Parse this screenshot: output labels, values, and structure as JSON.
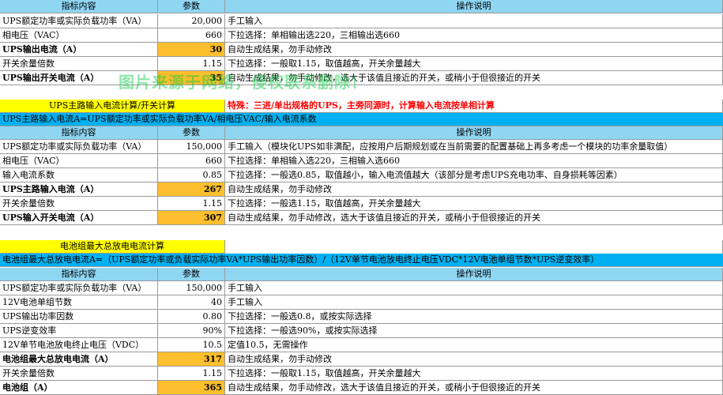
{
  "headers": {
    "col1": "指标内容",
    "col2": "参数",
    "col3": "操作说明"
  },
  "section1": {
    "rows": [
      {
        "label": "UPS额定功率或实际负载功率（VA）",
        "value": "20,000",
        "note": "手工输入",
        "bold": false,
        "highlight": false
      },
      {
        "label": "相电压（VAC）",
        "value": "660",
        "note": "下拉选择：单相输出选220，三相输出选660",
        "bold": false,
        "highlight": false
      },
      {
        "label": "UPS输出电流（A）",
        "value": "30",
        "note": "自动生成结果，勿手动修改",
        "bold": true,
        "highlight": true
      },
      {
        "label": "开关余量倍数",
        "value": "1.15",
        "note": "下拉选择：一般取1.15，取值越高，开关余量越大",
        "bold": false,
        "highlight": false
      },
      {
        "label": "UPS输出开关电流（A）",
        "value": "35",
        "note": "自动生成结果，勿手动修改，选大于该值且接近的开关，或稍小于但很接近的开关",
        "bold": true,
        "highlight": true
      }
    ]
  },
  "watermark": "图片来源于网络，侵权联系删除！",
  "section2": {
    "title": "UPS主路输入电流计算/开关计算",
    "special": "特殊：三进/单出规格的UPS，主旁同源时，计算输入电流按单相计算",
    "formula": "UPS主路输入电流A=UPS额定功率或实际负载功率VA/相电压VAC/输入电流系数",
    "rows": [
      {
        "label": "UPS额定功率或实际负载功率（VA）",
        "value": "150,000",
        "note": "手工输入（模块化UPS如非满配，应按用户后期规划或在当前需要的配置基础上再多考虑一个模块的功率余量取值）",
        "bold": false,
        "highlight": false
      },
      {
        "label": "相电压（VAC）",
        "value": "660",
        "note": "下拉选择：单相输入选220，三相输入选660",
        "bold": false,
        "highlight": false
      },
      {
        "label": "输入电流系数",
        "value": "0.85",
        "note": "下拉选择：一般选0.85，取值越小，输入电流值越大（该部分是考虑UPS充电功率、自身损耗等因素）",
        "bold": false,
        "highlight": false
      },
      {
        "label": "UPS主路输入电流（A）",
        "value": "267",
        "note": "自动生成结果，勿手动修改",
        "bold": true,
        "highlight": true
      },
      {
        "label": "开关余量倍数",
        "value": "1.15",
        "note": "下拉选择：一般选1.15，取值越高，开关余量越大",
        "bold": false,
        "highlight": false
      },
      {
        "label": "UPS输入开关电流（A）",
        "value": "307",
        "note": "自动生成结果，勿手动修改，选大于该值且接近的开关，或稍小于但很接近的开关",
        "bold": true,
        "highlight": true
      }
    ]
  },
  "section3": {
    "title": "电池组最大总放电电流计算",
    "formula": "电池组最大总放电电流A=（UPS额定功率或负载实际功率VA*UPS输出功率因数）/（12V单节电池放电终止电压VDC*12V电池单组节数*UPS逆变效率）",
    "rows": [
      {
        "label": "UPS额定功率或实际负载功率（VA）",
        "value": "150,000",
        "note": "手工输入",
        "bold": false,
        "highlight": false
      },
      {
        "label": "12V电池单组节数",
        "value": "40",
        "note": "手工输入",
        "bold": false,
        "highlight": false
      },
      {
        "label": "UPS输出功率因数",
        "value": "0.80",
        "note": "下拉选择：一般选0.8，或按实际选择",
        "bold": false,
        "highlight": false
      },
      {
        "label": "UPS逆变效率",
        "value": "90%",
        "note": "下拉选择：一般选90%，或按实际选择",
        "bold": false,
        "highlight": false
      },
      {
        "label": "12V单节电池放电终止电压（VDC）",
        "value": "10.5",
        "note": "定值10.5，无需操作",
        "bold": false,
        "highlight": false
      },
      {
        "label": "电池组最大总放电电流（A）",
        "value": "317",
        "note": "自动生成结果，勿手动修改",
        "bold": true,
        "highlight": true
      },
      {
        "label": "开关余量倍数",
        "value": "1.15",
        "note": "下拉选择：一般取1.15，取值越高，开关余量越大",
        "bold": false,
        "highlight": false
      },
      {
        "label": "电池组（A）",
        "value": "365",
        "note": "自动生成结果，勿手动修改，选大于该值且接近的开关，或稍小于但很接近的开关",
        "bold": true,
        "highlight": true
      }
    ]
  }
}
